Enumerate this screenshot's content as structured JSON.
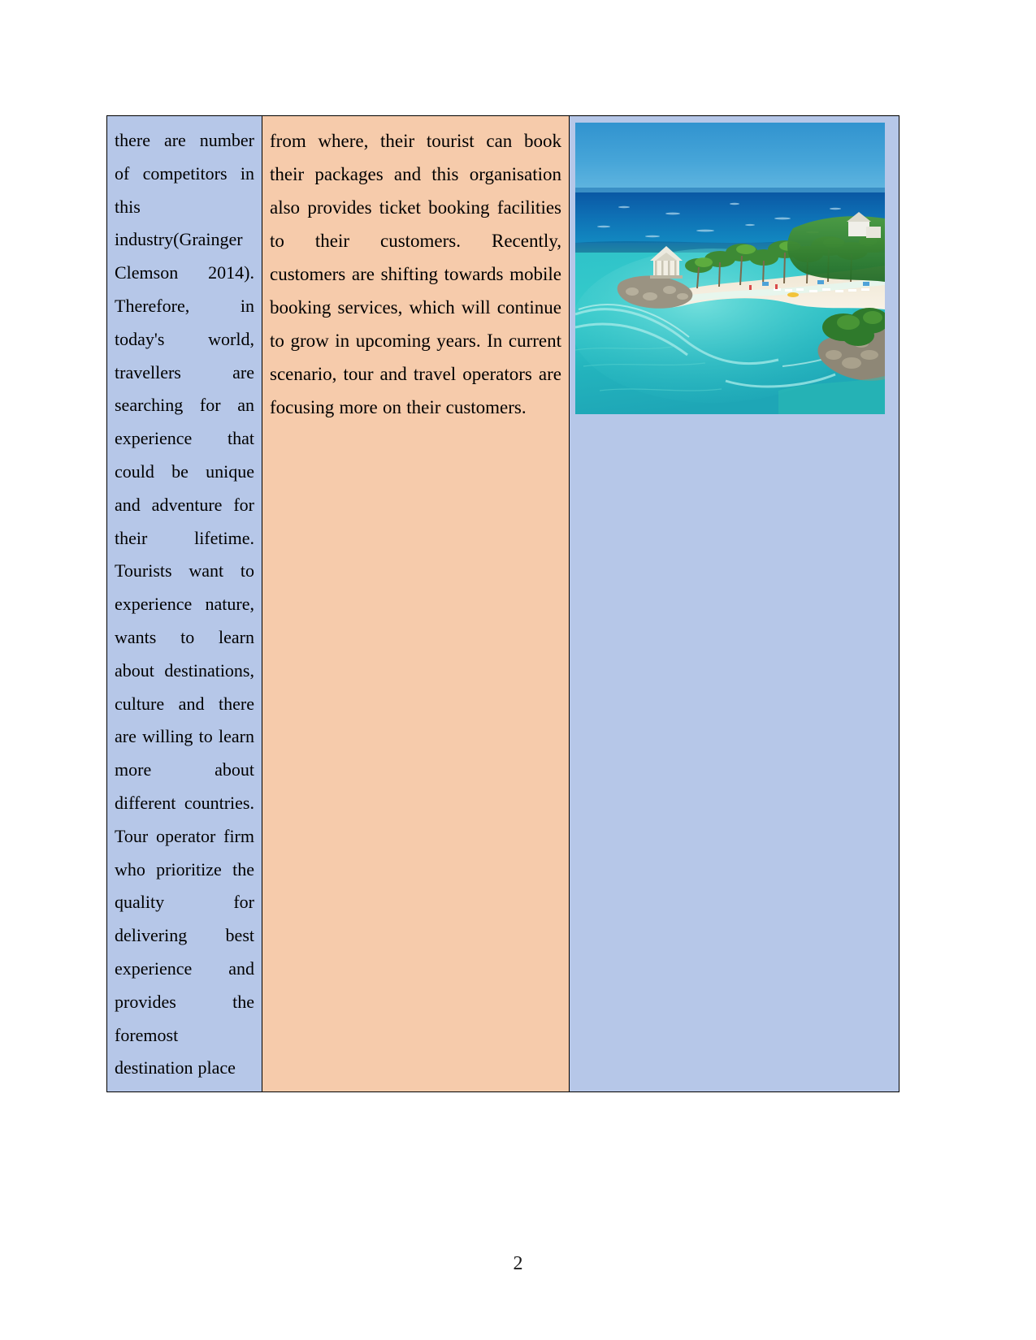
{
  "document": {
    "page_number": "2",
    "table": {
      "columns": [
        {
          "id": "left-text-column",
          "background_color": "#b6c7e8",
          "text": "there are number of competitors in this industry(Grainger Clemson 2014). Therefore, in today's world, travellers are searching for an experience that could be unique and adventure for their lifetime. Tourists want to experience nature, wants to learn about destinations, culture and there are willing to learn more about different countries. Tour operator firm who prioritize the quality for delivering best experience and provides the foremost destination place"
        },
        {
          "id": "middle-text-column",
          "background_color": "#f6cbab",
          "text": "from where, their tourist can book their packages and this organisation also provides ticket booking facilities to their customers. Recently, customers are shifting towards mobile booking services, which will continue to grow in upcoming years. In current scenario, tour and travel operators are focusing more on their customers."
        },
        {
          "id": "image-column",
          "background_color": "#b6c7e8",
          "image": {
            "alt": "Aerial view of a tropical Caribbean island resort with turquoise sea, white sand beach, palm trees and a white gazebo",
            "colors": {
              "sky": "#3f9fd4",
              "deep_ocean": "#0d5fa8",
              "mid_ocean": "#1396c4",
              "shallow_lagoon": "#2ec6c6",
              "turquoise": "#3fd4cf",
              "sand": "#f3ece0",
              "foliage": "#3c8a34",
              "rock": "#8a8578"
            }
          }
        }
      ]
    }
  }
}
